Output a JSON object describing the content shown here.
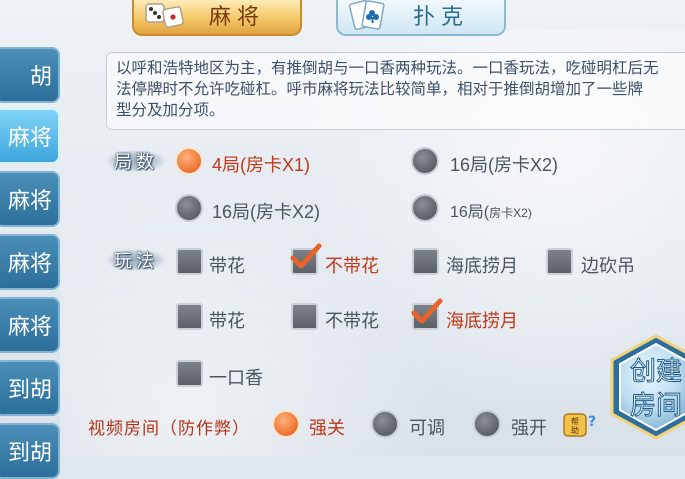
{
  "tabs": [
    {
      "label": "麻将",
      "active": true
    },
    {
      "label": "扑克",
      "active": false
    }
  ],
  "sidebar": {
    "items": [
      {
        "label": "胡",
        "active": false
      },
      {
        "label": "麻将",
        "active": true
      },
      {
        "label": "麻将",
        "active": false
      },
      {
        "label": "麻将",
        "active": false
      },
      {
        "label": "麻将",
        "active": false
      },
      {
        "label": "到胡",
        "active": false
      },
      {
        "label": "到胡",
        "active": false
      }
    ]
  },
  "description": {
    "line1": "以呼和浩特地区为主，有推倒胡与一口香两种玩法。一口香玩法，吃碰明杠后无",
    "line2": "法停牌时不允许吃碰杠。呼市麻将玩法比较简单，相对于推倒胡增加了一些牌",
    "line3": "型分及加分项。"
  },
  "rounds": {
    "label": "局数",
    "options": [
      {
        "text": "4局(房卡X1)",
        "selected": true
      },
      {
        "text": "16局(房卡X2)",
        "selected": false
      },
      {
        "text": "16局(房卡X2)",
        "selected": false
      },
      {
        "text_main": "16局(",
        "text_small": "房卡X2)",
        "selected": false
      }
    ]
  },
  "play": {
    "label": "玩法",
    "options": [
      {
        "text": "带花",
        "checked": false
      },
      {
        "text": "不带花",
        "checked": true
      },
      {
        "text": "海底捞月",
        "checked": false
      },
      {
        "text": "边砍吊",
        "checked": false
      },
      {
        "text": "带花",
        "checked": false
      },
      {
        "text": "不带花",
        "checked": false
      },
      {
        "text": "海底捞月",
        "checked": true
      },
      {
        "text": "一口香",
        "checked": false
      }
    ]
  },
  "video_room": {
    "label": "视频房间（防作弊）",
    "options": [
      {
        "text": "强关",
        "selected": true
      },
      {
        "text": "可调",
        "selected": false
      },
      {
        "text": "强开",
        "selected": false
      }
    ],
    "help_label": "帮助"
  },
  "create_button": {
    "line1": "创建",
    "line2": "房间"
  },
  "colors": {
    "selected_text": "#c0391b",
    "accent_orange": "#f07a3a",
    "panel_blue": "#2c6f9a"
  }
}
